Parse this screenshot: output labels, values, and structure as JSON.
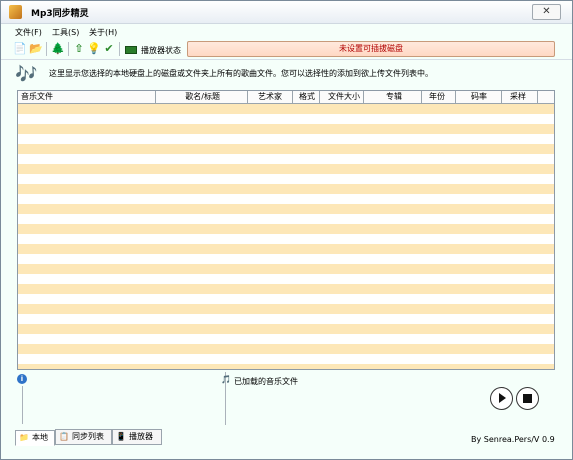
{
  "window": {
    "title": "Mp3同步精灵",
    "close_glyph": "✕"
  },
  "menubar": {
    "items": [
      {
        "label": "文件(F)"
      },
      {
        "label": "工具(S)"
      },
      {
        "label": "关于(H)"
      }
    ]
  },
  "toolbar": {
    "buttons": [
      {
        "icon": "add-files-icon",
        "glyph": "📄"
      },
      {
        "icon": "open-folder-icon",
        "glyph": "📂"
      },
      {
        "icon": "sync-tree-icon",
        "glyph": "🌲"
      },
      {
        "icon": "upload-icon",
        "glyph": "⇧"
      },
      {
        "icon": "lightbulb-icon",
        "glyph": "💡"
      },
      {
        "icon": "checkmark-icon",
        "glyph": "✔"
      }
    ],
    "player_status_label": "播放器状态",
    "device_status": "未设置可插拔磁盘"
  },
  "info": {
    "icon": "music-notes-icon",
    "glyph": "🎶",
    "text": "这里显示您选择的本地硬盘上的磁盘或文件夹上所有的歌曲文件。您可以选择性的添加到欲上传文件列表中。"
  },
  "table": {
    "columns": [
      {
        "label": "音乐文件",
        "align": "left"
      },
      {
        "label": "歌名/标题",
        "align": "right"
      },
      {
        "label": "艺术家",
        "align": "right"
      },
      {
        "label": "格式",
        "align": "right"
      },
      {
        "label": "文件大小",
        "align": "right"
      },
      {
        "label": "专辑",
        "align": "right"
      },
      {
        "label": "年份",
        "align": "right"
      },
      {
        "label": "码率",
        "align": "right"
      },
      {
        "label": "采样",
        "align": "right"
      }
    ],
    "row_count": 27,
    "stripe_color": "#fde7b8"
  },
  "bottom": {
    "info_glyph": "i",
    "loaded_label": "已加载的音乐文件",
    "loaded_icon": "music-file-icon"
  },
  "tabs": [
    {
      "label": "本地",
      "icon": "folder-icon",
      "glyph": "📁",
      "active": true
    },
    {
      "label": "同步列表",
      "icon": "list-icon",
      "glyph": "📋",
      "active": false
    },
    {
      "label": "播放器",
      "icon": "player-icon",
      "glyph": "📱",
      "active": false
    }
  ],
  "credit": "By Senrea.Pers/V 0.9"
}
